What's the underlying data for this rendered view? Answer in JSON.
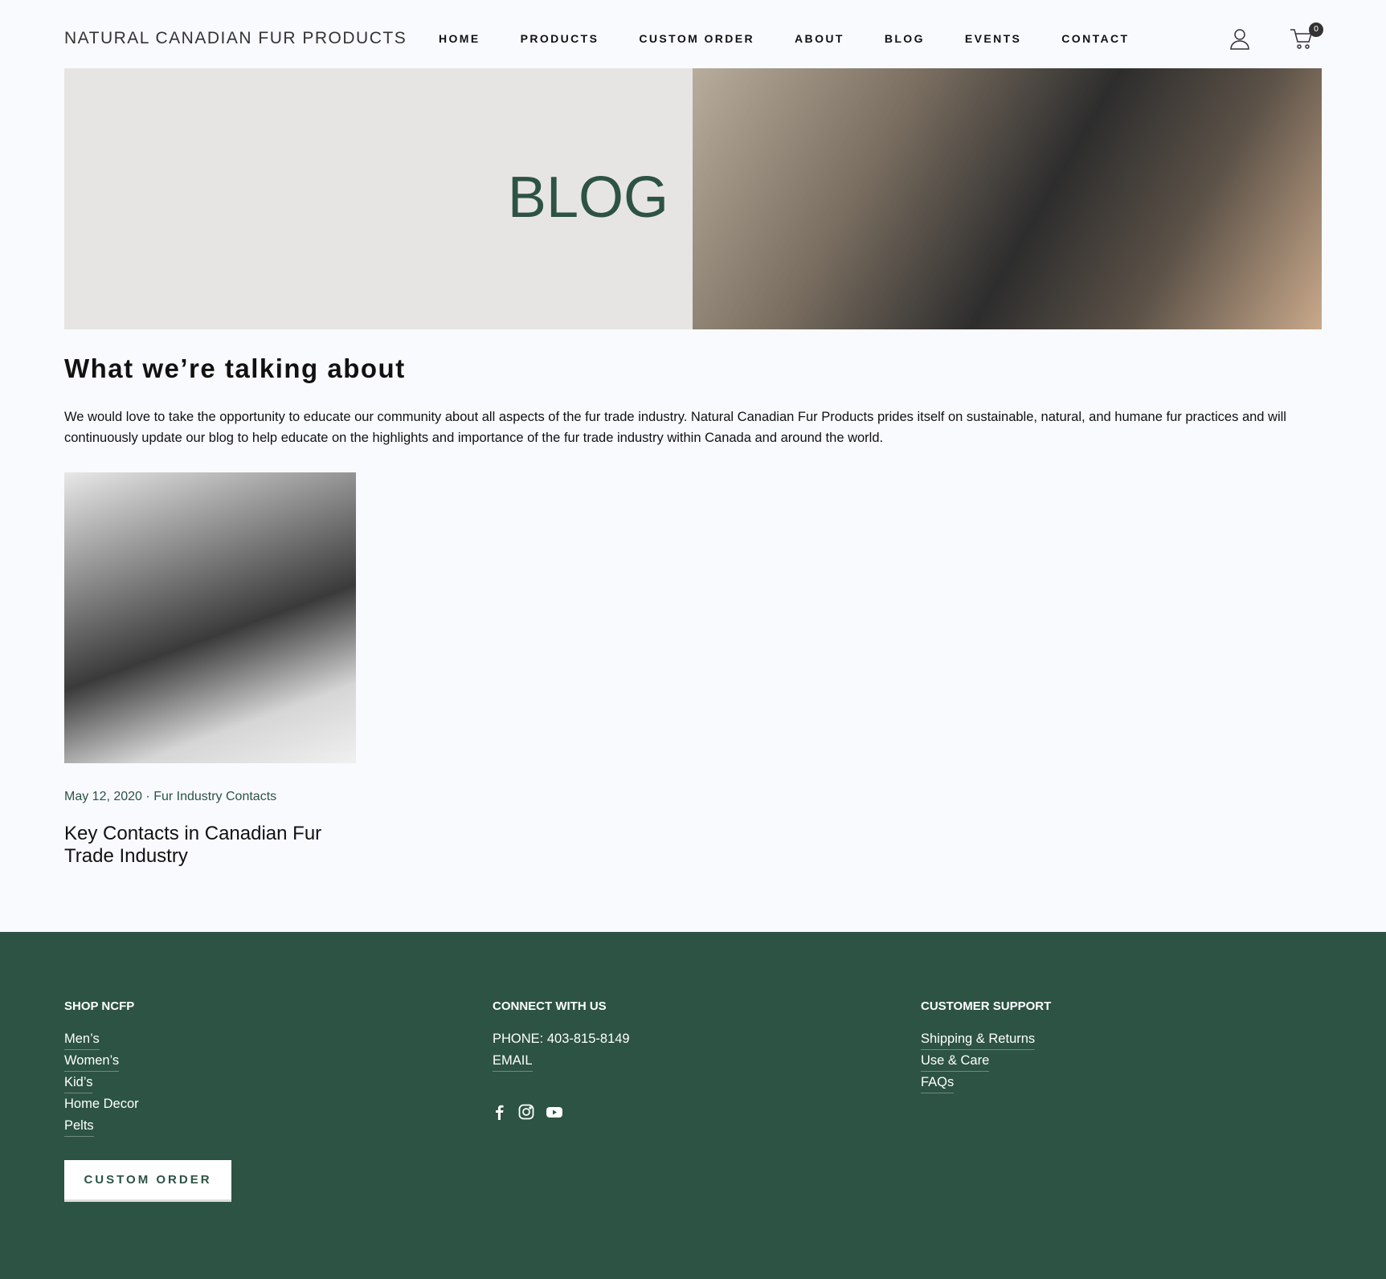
{
  "header": {
    "logo": "NATURAL CANADIAN FUR PRODUCTS",
    "nav": [
      "HOME",
      "PRODUCTS",
      "CUSTOM ORDER",
      "ABOUT",
      "BLOG",
      "EVENTS",
      "CONTACT"
    ],
    "cart_count": "0"
  },
  "hero": {
    "title": "BLOG"
  },
  "intro": {
    "heading": "What we’re talking about",
    "text": "We would love to take the opportunity to educate our community about all aspects of the fur trade industry. Natural Canadian Fur Products prides itself on sustainable, natural, and humane fur practices and will continuously update our blog to help educate on the highlights and importance of the fur trade industry within Canada and around the world."
  },
  "posts": [
    {
      "date": "May 12, 2020",
      "separator": "·",
      "category": "Fur Industry Contacts",
      "title": "Key Contacts in Canadian Fur Trade Industry"
    }
  ],
  "footer": {
    "shop": {
      "heading": "SHOP NCFP",
      "links": [
        "Men’s",
        "Women’s",
        "Kid’s",
        "Home Decor",
        "Pelts"
      ]
    },
    "connect": {
      "heading": "CONNECT WITH US",
      "phone": "PHONE: 403-815-8149",
      "email": "EMAIL"
    },
    "support": {
      "heading": "CUSTOMER SUPPORT",
      "links": [
        "Shipping & Returns",
        "Use & Care",
        "FAQs"
      ]
    },
    "button": "CUSTOM ORDER"
  },
  "colors": {
    "brand": "#2c5343",
    "hero_bg": "#e7e5e3"
  }
}
